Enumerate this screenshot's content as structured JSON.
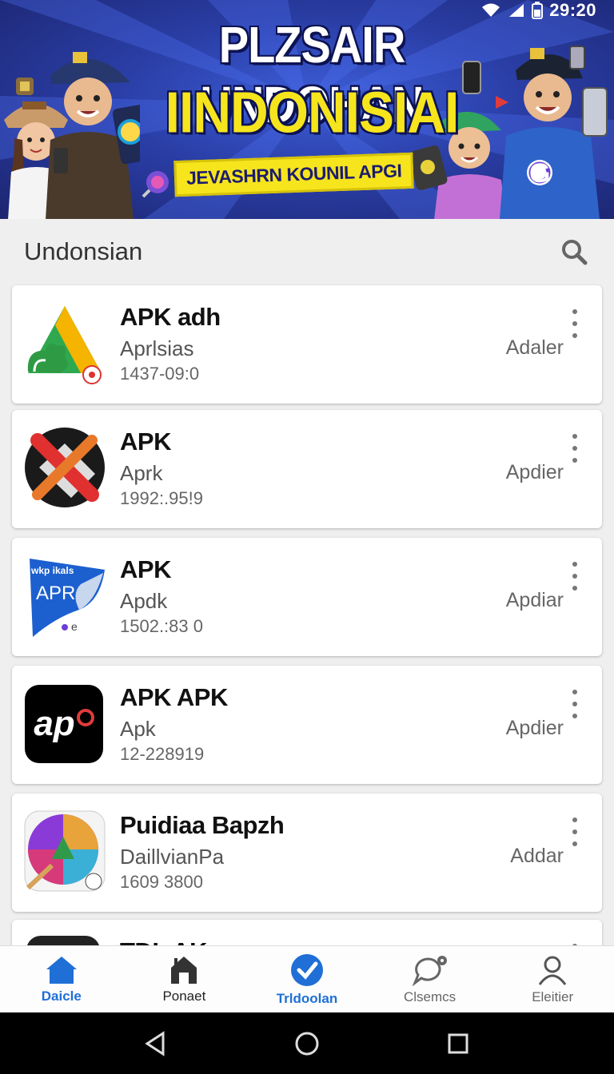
{
  "status_bar": {
    "time": "29:20"
  },
  "banner": {
    "title_line1": "PLZSAIR UNDOHAN",
    "title_line2": "IINDONISIAI",
    "subtitle": "JEVASHRN KOUNIL APGI",
    "badge_text": "G"
  },
  "header": {
    "title": "Undonsian"
  },
  "apps": [
    {
      "name": "APK adh",
      "subtitle": "Aprlsias",
      "meta": "1437-09:0",
      "action": "Adaler"
    },
    {
      "name": "APK",
      "subtitle": "Aprk",
      "meta": "1992:.95!9",
      "action": "Apdier"
    },
    {
      "name": "APK",
      "subtitle": "Apdk",
      "meta": "1502.:83 0",
      "action": "Apdiar",
      "icon_text": "APR",
      "icon_small": "wkp ikals"
    },
    {
      "name": "APK APK",
      "subtitle": "Apk",
      "meta": "12-228919",
      "action": "Apdier",
      "icon_text": "ap"
    },
    {
      "name": "Puidiaa Bapzh",
      "subtitle": "DaillvianPa",
      "meta": "1609 3800",
      "action": "Addar"
    },
    {
      "name": "TDL AK",
      "subtitle": "",
      "meta": "",
      "action": ""
    }
  ],
  "nav": [
    {
      "label": "Daicle",
      "icon": "home-icon"
    },
    {
      "label": "Ponaet",
      "icon": "store-icon"
    },
    {
      "label": "Trldoolan",
      "icon": "check-circle-icon"
    },
    {
      "label": "Clsemcs",
      "icon": "chat-settings-icon"
    },
    {
      "label": "Eleitier",
      "icon": "person-icon"
    }
  ],
  "colors": {
    "accent": "#1f6fd6",
    "banner_bg": "#2a3ea6",
    "banner_yellow": "#f6e51d"
  }
}
